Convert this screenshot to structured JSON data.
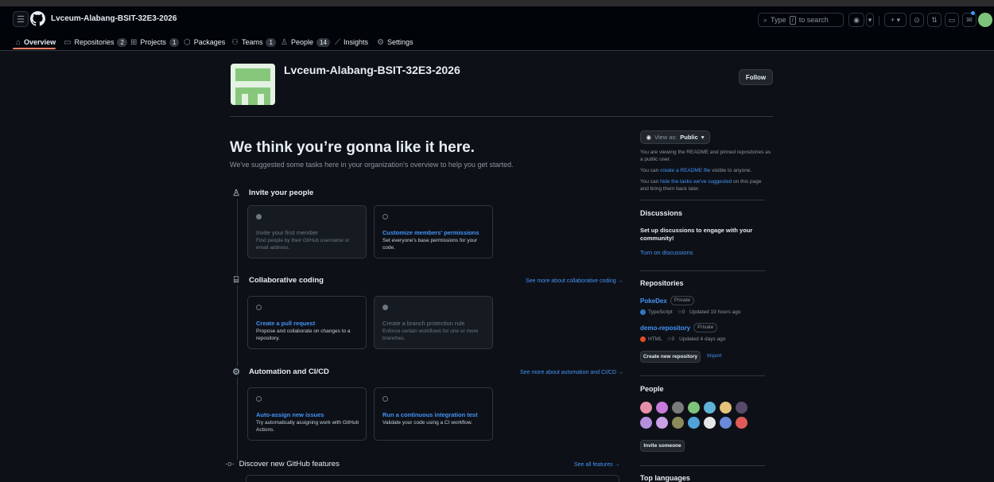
{
  "header": {
    "org_name": "Lvceum-Alabang-BSIT-32E3-2026",
    "search_prefix": "Type",
    "search_key": "/",
    "search_suffix": "to search"
  },
  "tabs": [
    {
      "label": "Overview",
      "icon": "home-icon"
    },
    {
      "label": "Repositories",
      "count": "2",
      "icon": "repo-icon"
    },
    {
      "label": "Projects",
      "count": "1",
      "icon": "table-icon"
    },
    {
      "label": "Packages",
      "icon": "package-icon"
    },
    {
      "label": "Teams",
      "count": "1",
      "icon": "people-icon"
    },
    {
      "label": "People",
      "count": "14",
      "icon": "person-icon"
    },
    {
      "label": "Insights",
      "icon": "graph-icon"
    },
    {
      "label": "Settings",
      "icon": "gear-icon"
    }
  ],
  "org": {
    "title": "Lvceum-Alabang-BSIT-32E3-2026",
    "follow_label": "Follow"
  },
  "main": {
    "hero_title": "We think you’re gonna like it here.",
    "hero_subtitle": "We've suggested some tasks here in your organization's overview to help you get started.",
    "sections": [
      {
        "title": "Invite your people",
        "cards": [
          {
            "title": "Invite your first member",
            "desc": "Find people by their GitHub username or email address.",
            "done": true
          },
          {
            "title": "Customize members' permissions",
            "desc": "Set everyone's base permissions for your code.",
            "done": false
          }
        ]
      },
      {
        "title": "Collaborative coding",
        "see_more": "See more about collaborative coding →",
        "cards": [
          {
            "title": "Create a pull request",
            "desc": "Propose and collaborate on changes to a repository.",
            "done": false
          },
          {
            "title": "Create a branch protection rule",
            "desc": "Enforce certain workflows for one or more branches.",
            "done": true
          }
        ]
      },
      {
        "title": "Automation and CI/CD",
        "see_more": "See more about automation and CI/CD →",
        "cards": [
          {
            "title": "Auto-assign new issues",
            "desc": "Try automatically assigning work with GitHub Actions.",
            "done": false
          },
          {
            "title": "Run a continuous integration test",
            "desc": "Validate your code using a CI workflow.",
            "done": false
          }
        ]
      }
    ],
    "discover_title": "Discover new GitHub features",
    "discover_link": "See all features →"
  },
  "sidebar": {
    "view_as_prefix": "View as:",
    "view_as_value": "Public",
    "readme_note": "You are viewing the README and pinned repositories as a public user.",
    "can_prefix": "You can",
    "create_readme_link": "create a README file",
    "create_readme_suffix": "visible to anyone.",
    "hide_link": "hide the tasks we've suggested",
    "hide_suffix": "on this page and bring them back later.",
    "discussions_title": "Discussions",
    "discussions_body": "Set up discussions to engage with your community!",
    "discussions_link": "Turn on discussions",
    "repos_title": "Repositories",
    "repos": [
      {
        "name": "PokeDex",
        "visibility": "Private",
        "language": "TypeScript",
        "lang_color": "#3178c6",
        "stars": "0",
        "updated": "Updated 19 hours ago"
      },
      {
        "name": "demo-repository",
        "visibility": "Private",
        "language": "HTML",
        "lang_color": "#e34c26",
        "stars": "0",
        "updated": "Updated 4 days ago"
      }
    ],
    "create_repo_label": "Create new repository",
    "import_label": "Import",
    "people_title": "People",
    "invite_label": "Invite someone",
    "top_languages_title": "Top languages"
  }
}
